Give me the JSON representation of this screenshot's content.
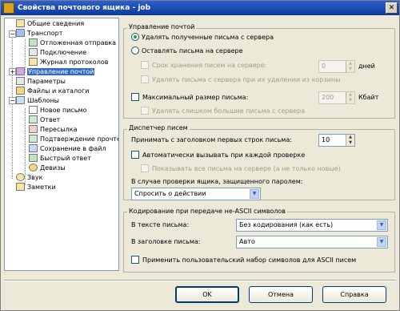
{
  "window": {
    "title": "Свойства почтового ящика - job",
    "close_label": "✕"
  },
  "tree": {
    "items": [
      {
        "label": "Общие сведения"
      },
      {
        "label": "Транспорт"
      },
      {
        "label": "Отложенная отправка"
      },
      {
        "label": "Подключение"
      },
      {
        "label": "Журнал протоколов"
      },
      {
        "label": "Управление почтой"
      },
      {
        "label": "Параметры"
      },
      {
        "label": "Файлы и каталоги"
      },
      {
        "label": "Шаблоны"
      },
      {
        "label": "Новое письмо"
      },
      {
        "label": "Ответ"
      },
      {
        "label": "Пересылка"
      },
      {
        "label": "Подтверждение прочтения"
      },
      {
        "label": "Сохранение в файл"
      },
      {
        "label": "Быстрый ответ"
      },
      {
        "label": "Девизы"
      },
      {
        "label": "Звук"
      },
      {
        "label": "Заметки"
      }
    ],
    "expander_minus": "−",
    "expander_plus": "+"
  },
  "mail_management": {
    "title": "Управление почтой",
    "delete_received": "Удалять полученные письма с сервера",
    "keep_on_server": "Оставлять письма на сервере",
    "retention_label": "Срок хранения писем на сервере:",
    "retention_value": "0",
    "retention_unit": "дней",
    "delete_on_trash": "Удалять письма с сервера при их удалении из корзины",
    "max_size_label": "Максимальный размер письма:",
    "max_size_value": "200",
    "max_size_unit": "Кбайт",
    "delete_too_big": "Удалять слишком большие письма с сервера"
  },
  "dispatcher": {
    "title": "Диспетчер писем",
    "header_lines_label": "Принимать с заголовком первых строк письма:",
    "header_lines_value": "10",
    "auto_call": "Автоматически вызывать при каждой проверке",
    "show_all": "Показывать все письма на сервере (а не только новые)",
    "password_label": "В случае проверки ящика, защищенного паролем:",
    "password_option": "Спросить о действии"
  },
  "encoding": {
    "title": "Кодирование при передаче не-ASCII символов",
    "body_label": "В тексте письма:",
    "body_value": "Без кодирования (как есть)",
    "header_label": "В заголовке письма:",
    "header_value": "Авто",
    "custom_charset": "Применить пользовательский набор символов для ASCII писем"
  },
  "buttons": {
    "ok": "OK",
    "cancel": "Отмена",
    "help": "Справка"
  },
  "arrows": {
    "up": "▲",
    "down": "▼"
  }
}
